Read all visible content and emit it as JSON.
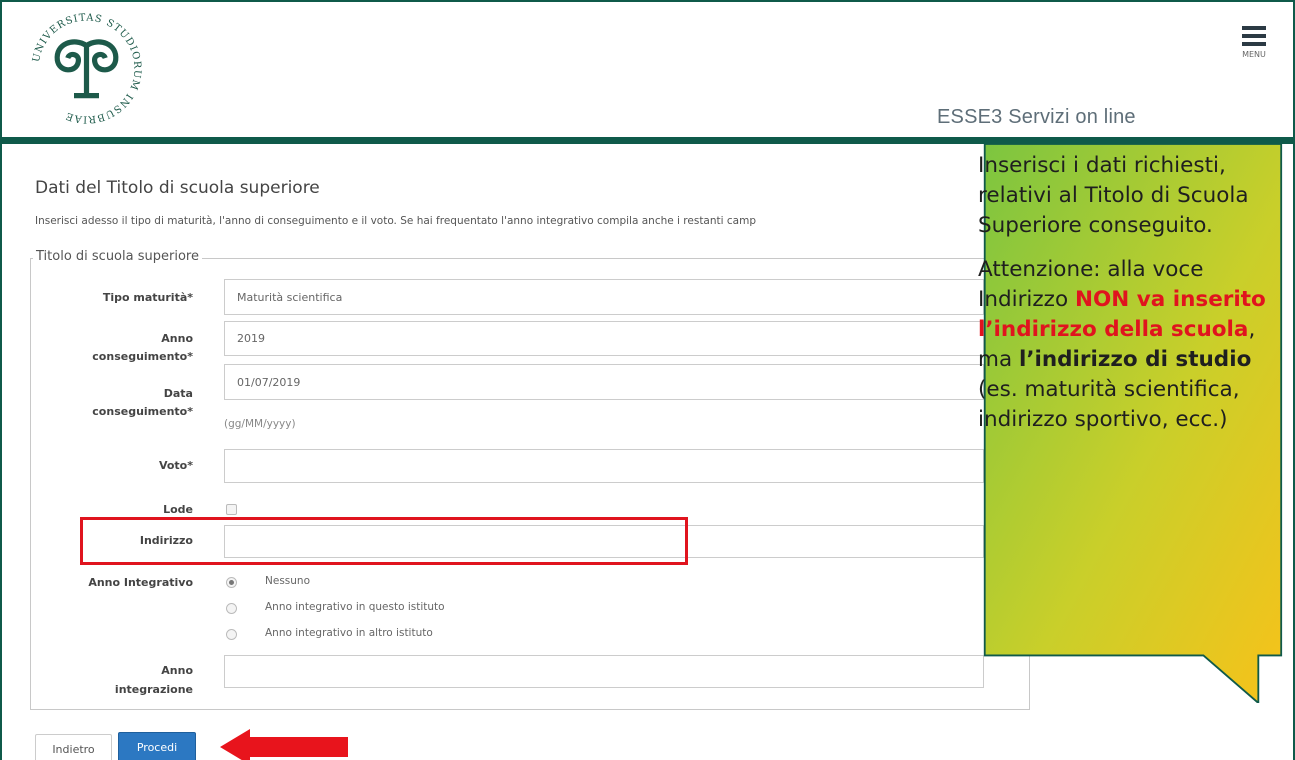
{
  "header": {
    "logo_text": "UNIVERSITAS STUDIORUM INSUBRIAE",
    "menu_label": "MENU",
    "service_title": "ESSE3 Servizi on line"
  },
  "main": {
    "page_title": "Dati del Titolo di scuola superiore",
    "intro": "Inserisci adesso il tipo di maturità, l'anno di conseguimento e il voto. Se hai frequentato l'anno integrativo compila anche i restanti camp",
    "legend": "Titolo di scuola superiore",
    "fields": {
      "tipo_maturita": {
        "label": "Tipo maturità*",
        "value": "Maturità scientifica"
      },
      "anno_conseguimento": {
        "label_1": "Anno",
        "label_2": "conseguimento*",
        "value": "2019"
      },
      "data_conseguimento": {
        "label_1": "Data",
        "label_2": "conseguimento*",
        "value": "01/07/2019",
        "hint": "(gg/MM/yyyy)"
      },
      "voto": {
        "label": "Voto*",
        "value": ""
      },
      "lode": {
        "label": "Lode",
        "checked": false
      },
      "indirizzo": {
        "label": "Indirizzo",
        "value": ""
      },
      "anno_integrativo": {
        "label": "Anno Integrativo",
        "options": [
          "Nessuno",
          "Anno integrativo in questo istituto",
          "Anno integrativo in altro istituto"
        ],
        "selected": "Nessuno"
      },
      "anno_integrazione": {
        "label_1": "Anno",
        "label_2": "integrazione",
        "value": ""
      }
    },
    "buttons": {
      "back": "Indietro",
      "next": "Procedi"
    }
  },
  "callout": {
    "para1": "Inserisci i dati richiesti, relativi al Titolo di Scuola Superiore conseguito.",
    "para2_a": "Attenzione: alla voce Indirizzo ",
    "para2_red": "NON va inserito l’indirizzo della scuola",
    "para2_b": ", ma ",
    "para2_bold": "l’indirizzo di studio",
    "para2_c": " (es. maturità scientifica, indirizzo sportivo, ecc.)"
  },
  "colors": {
    "brand_green": "#0f5a4a",
    "primary_button": "#2c78c2",
    "highlight_red": "#e0141e",
    "callout_gradient_start": "#7cc540",
    "callout_gradient_end": "#f7c21a"
  }
}
